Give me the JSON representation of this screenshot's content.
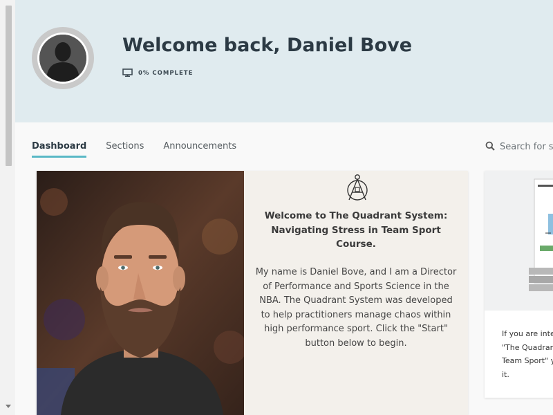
{
  "header": {
    "welcome": "Welcome back, Daniel Bove",
    "progress_label": "0% COMPLETE",
    "progress_percent": 0
  },
  "tabs": [
    {
      "label": "Dashboard",
      "active": true
    },
    {
      "label": "Sections",
      "active": false
    },
    {
      "label": "Announcements",
      "active": false
    }
  ],
  "search": {
    "placeholder": "Search for so"
  },
  "main_card": {
    "title": "Welcome to The Quadrant System: Navigating Stress in Team Sport Course.",
    "body": "My name is Daniel Bove, and I am a Director of Performance and Sports Science in the NBA. The Quadrant System was developed to help practitioners manage chaos within high performance sport. Click the \"Start\" button below to begin."
  },
  "side_card": {
    "text": "If you are inter\n\"The Quadrant\nTeam Sport\" y\nit."
  },
  "colors": {
    "hero_bg": "#e0ebef",
    "tab_underline": "#59b8c6",
    "heading": "#2c3a44"
  },
  "icons": [
    "user-silhouette-icon",
    "monitor-icon",
    "search-icon",
    "quadrant-logo-icon"
  ]
}
